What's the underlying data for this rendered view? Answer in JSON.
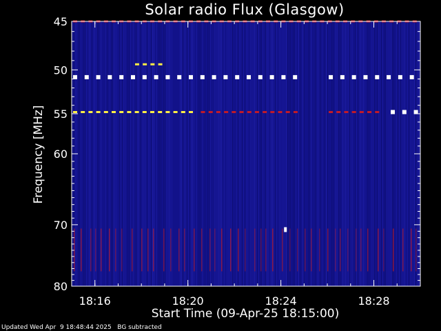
{
  "chart_data": {
    "type": "heatmap",
    "title": "Solar radio Flux (Glasgow)",
    "xlabel": "Start Time (09-Apr-25 18:15:00)",
    "ylabel": "Frequency [MHz]",
    "x_range": [
      "18:15:00",
      "18:30:00"
    ],
    "x_ticks": [
      "18:16",
      "18:20",
      "18:24",
      "18:28"
    ],
    "y_range": [
      45,
      80
    ],
    "y_ticks": [
      45,
      50,
      55,
      60,
      70,
      80
    ],
    "y_scale": "log",
    "colormap": "blue-red-yellow-white",
    "background_color": "#12128a",
    "features": [
      {
        "frequency_mhz": 45.0,
        "x_start": "18:15:00",
        "x_end": "18:30:00",
        "level": "red",
        "pattern": "dashed"
      },
      {
        "frequency_mhz": 49.4,
        "x_start": "18:17:40",
        "x_end": "18:19:00",
        "level": "yellow",
        "pattern": "dashed"
      },
      {
        "frequency_mhz": 50.8,
        "x_start": "18:15:00",
        "x_end": "18:24:45",
        "level": "white",
        "pattern": "dashed"
      },
      {
        "frequency_mhz": 50.8,
        "x_start": "18:26:00",
        "x_end": "18:30:00",
        "level": "white",
        "pattern": "dashed"
      },
      {
        "frequency_mhz": 54.8,
        "x_start": "18:15:00",
        "x_end": "18:20:30",
        "level": "yellow",
        "pattern": "dashed"
      },
      {
        "frequency_mhz": 54.8,
        "x_start": "18:20:30",
        "x_end": "18:24:45",
        "level": "red",
        "pattern": "dashed"
      },
      {
        "frequency_mhz": 54.8,
        "x_start": "18:26:00",
        "x_end": "18:28:30",
        "level": "red",
        "pattern": "dashed"
      },
      {
        "frequency_mhz": 54.8,
        "x_start": "18:28:40",
        "x_end": "18:30:00",
        "level": "white",
        "pattern": "dashed"
      },
      {
        "frequency_mhz": 70.8,
        "x_start": "18:24:10",
        "x_end": "18:24:15",
        "level": "white",
        "pattern": "spot"
      },
      {
        "frequency_mhz": 74.5,
        "x_start": "18:15:00",
        "x_end": "18:30:00",
        "level": "red",
        "pattern": "faint-streaks"
      }
    ]
  },
  "footer": {
    "updated": "Updated Wed Apr  9 18:48:44 2025   BG subtracted"
  }
}
